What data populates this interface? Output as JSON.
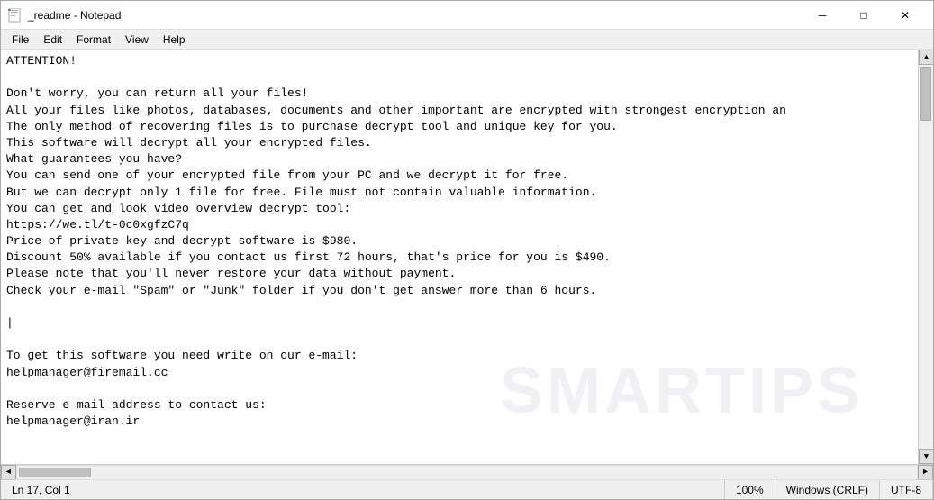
{
  "window": {
    "title": "_readme - Notepad",
    "icon": "📄"
  },
  "titlebar": {
    "minimize_label": "─",
    "maximize_label": "□",
    "close_label": "✕"
  },
  "menubar": {
    "items": [
      "File",
      "Edit",
      "Format",
      "View",
      "Help"
    ]
  },
  "content": {
    "text": "ATTENTION!\n\nDon't worry, you can return all your files!\nAll your files like photos, databases, documents and other important are encrypted with strongest encryption an\nThe only method of recovering files is to purchase decrypt tool and unique key for you.\nThis software will decrypt all your encrypted files.\nWhat guarantees you have?\nYou can send one of your encrypted file from your PC and we decrypt it for free.\nBut we can decrypt only 1 file for free. File must not contain valuable information.\nYou can get and look video overview decrypt tool:\nhttps://we.tl/t-0c0xgfzC7q\nPrice of private key and decrypt software is $980.\nDiscount 50% available if you contact us first 72 hours, that's price for you is $490.\nPlease note that you'll never restore your data without payment.\nCheck your e-mail \"Spam\" or \"Junk\" folder if you don't get answer more than 6 hours.\n\n|\n\nTo get this software you need write on our e-mail:\nhelpmanager@firemail.cc\n\nReserve e-mail address to contact us:\nhelpmanager@iran.ir\n"
  },
  "watermark": {
    "text": "SMARTIPS"
  },
  "statusbar": {
    "position": "Ln 17, Col 1",
    "zoom": "100%",
    "line_ending": "Windows (CRLF)",
    "encoding": "UTF-8"
  },
  "scrollbar": {
    "up_arrow": "▲",
    "down_arrow": "▼",
    "left_arrow": "◄",
    "right_arrow": "►"
  }
}
